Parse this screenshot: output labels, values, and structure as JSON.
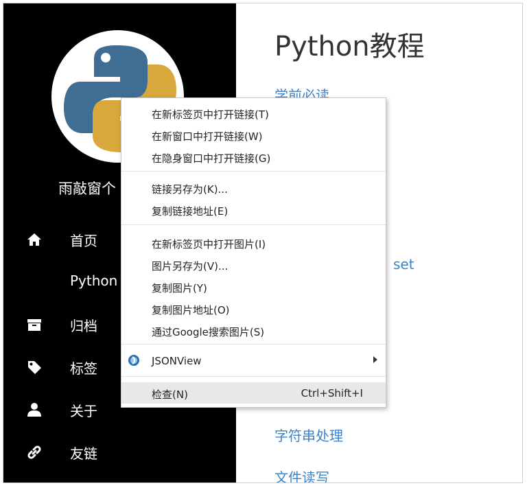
{
  "sidebar": {
    "site_name": "雨敲窗个",
    "nav": [
      {
        "label": "首页",
        "icon": "home-icon"
      },
      {
        "label": "Python",
        "icon": ""
      },
      {
        "label": "归档",
        "icon": "archive-icon"
      },
      {
        "label": "标签",
        "icon": "tag-icon"
      },
      {
        "label": "关于",
        "icon": "user-icon"
      },
      {
        "label": "友链",
        "icon": "link-icon"
      }
    ]
  },
  "main": {
    "title": "Python教程",
    "links": [
      "学前必读",
      "set",
      "字符串处理",
      "文件读写"
    ]
  },
  "context_menu": {
    "items": [
      {
        "label": "在新标签页中打开链接(T)"
      },
      {
        "label": "在新窗口中打开链接(W)"
      },
      {
        "label": "在隐身窗口中打开链接(G)"
      },
      {
        "label": "链接另存为(K)..."
      },
      {
        "label": "复制链接地址(E)"
      },
      {
        "label": "在新标签页中打开图片(I)"
      },
      {
        "label": "图片另存为(V)..."
      },
      {
        "label": "复制图片(Y)"
      },
      {
        "label": "复制图片地址(O)"
      },
      {
        "label": "通过Google搜索图片(S)"
      },
      {
        "label": "JSONView",
        "icon": "jsonview-icon",
        "submenu": true
      },
      {
        "label": "检查(N)",
        "shortcut": "Ctrl+Shift+I",
        "highlighted": true
      }
    ]
  },
  "colors": {
    "sidebar_bg": "#000000",
    "link": "#3b83c9",
    "python_blue": "#3f6d93",
    "python_yellow": "#d9a83c",
    "menu_highlight": "#e8e8e8"
  }
}
